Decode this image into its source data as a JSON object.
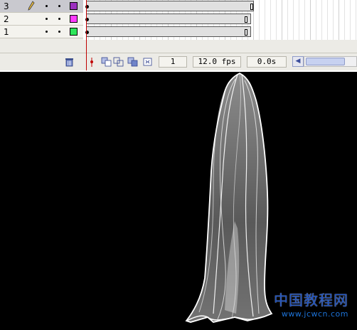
{
  "timeline": {
    "layers": [
      {
        "name": "3",
        "color": "#9b2fbf",
        "selected": true,
        "editing": true
      },
      {
        "name": "2",
        "color": "#ff3cff",
        "selected": false,
        "editing": false
      },
      {
        "name": "1",
        "color": "#2ee65a",
        "selected": false,
        "editing": false
      }
    ],
    "current_frame": "1",
    "frame_rate": "12.0 fps",
    "elapsed_time": "0.0s",
    "icons": [
      "trash-icon",
      "playhead-icon",
      "onion-skin-icon",
      "onion-skin-outlines-icon",
      "edit-multiple-frames-icon",
      "modify-onion-markers-icon",
      "scroll-left-icon"
    ]
  },
  "stage": {
    "background": "#000000",
    "watermark": {
      "main": "中国教程网",
      "url": "www.jcwcn.com"
    }
  }
}
